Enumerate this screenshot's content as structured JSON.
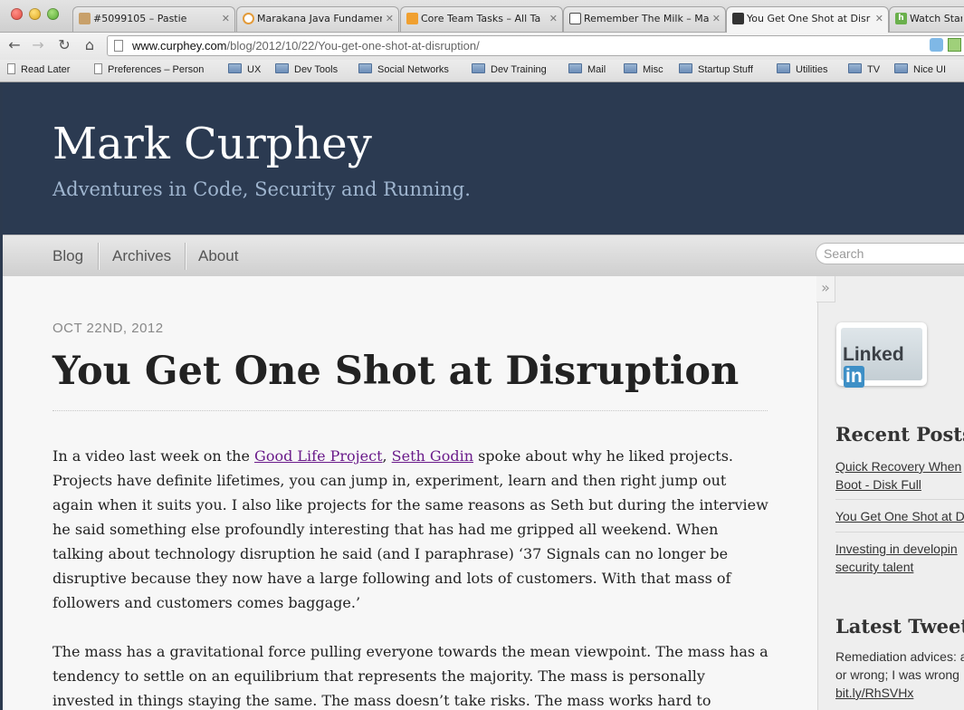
{
  "browser": {
    "tabs": [
      {
        "title": "#5099105 – Pastie",
        "icon": "pastie-icon",
        "color": "#c8a06a"
      },
      {
        "title": "Marakana Java Fundamen",
        "icon": "marakana-icon",
        "color": "#e39b3a"
      },
      {
        "title": "Core Team Tasks – All Ta",
        "icon": "tasks-icon",
        "color": "#f0a030"
      },
      {
        "title": "Remember The Milk – Ma",
        "icon": "cow-icon",
        "color": "#4a4a4a"
      },
      {
        "title": "You Get One Shot at Disr",
        "icon": "avatar-icon",
        "color": "#333333"
      },
      {
        "title": "Watch Startu",
        "icon": "h-icon",
        "color": "#6ab04c"
      }
    ],
    "url_host": "www.curphey.com",
    "url_path": "/blog/2012/10/22/You-get-one-shot-at-disruption/",
    "bookmarks": [
      "Read Later",
      "Preferences – Person",
      "UX",
      "Dev Tools",
      "Social Networks",
      "Dev Training",
      "Mail",
      "Misc",
      "Startup Stuff",
      "Utilities",
      "TV",
      "Nice UI"
    ]
  },
  "site": {
    "title": "Mark Curphey",
    "subtitle": "Adventures in Code, Security and Running."
  },
  "nav": {
    "blog": "Blog",
    "archives": "Archives",
    "about": "About",
    "search_placeholder": "Search"
  },
  "post": {
    "date": "OCT 22ND, 2012",
    "title": "You Get One Shot at Disruption",
    "p1_intro": "In a video last week on the ",
    "p1_link1": "Good Life Project",
    "p1_comma": ", ",
    "p1_link2": "Seth Godin",
    "p1_body": " spoke about why he liked projects. Projects have definite lifetimes, you can jump in, experiment, learn and then right jump out again when it suits you. I also like projects for the same reasons as Seth but during the interview he said something else profoundly interesting that has had me gripped all weekend. When talking about technology disruption he said (and I paraphrase) ‘37 Signals can no longer be disruptive because they now have a large following and lots of customers. With that mass of followers and customers comes baggage.’",
    "p2": "The mass has a gravitational force pulling everyone towards the mean viewpoint. The mass has a tendency to settle on an equilibrium that represents the majority. The mass is personally invested in things staying the same. The mass doesn’t take risks. The mass works hard to maintain a status"
  },
  "sidebar": {
    "collapse": "»",
    "linkedin_word": "Linked",
    "linkedin_in": "in",
    "recent_heading": "Recent Posts",
    "recent": [
      {
        "line1": "Quick Recovery When",
        "line2": "Boot - Disk Full"
      },
      {
        "line1": "You Get One Shot at D",
        "line2": ""
      },
      {
        "line1": "Investing in developin",
        "line2": "security talent"
      }
    ],
    "tweets_heading": "Latest Tweets",
    "tweet_line1": "Remediation advices: a",
    "tweet_line2": "or wrong; I was wrong",
    "tweet_link": "bit.ly/RhSVHx"
  }
}
